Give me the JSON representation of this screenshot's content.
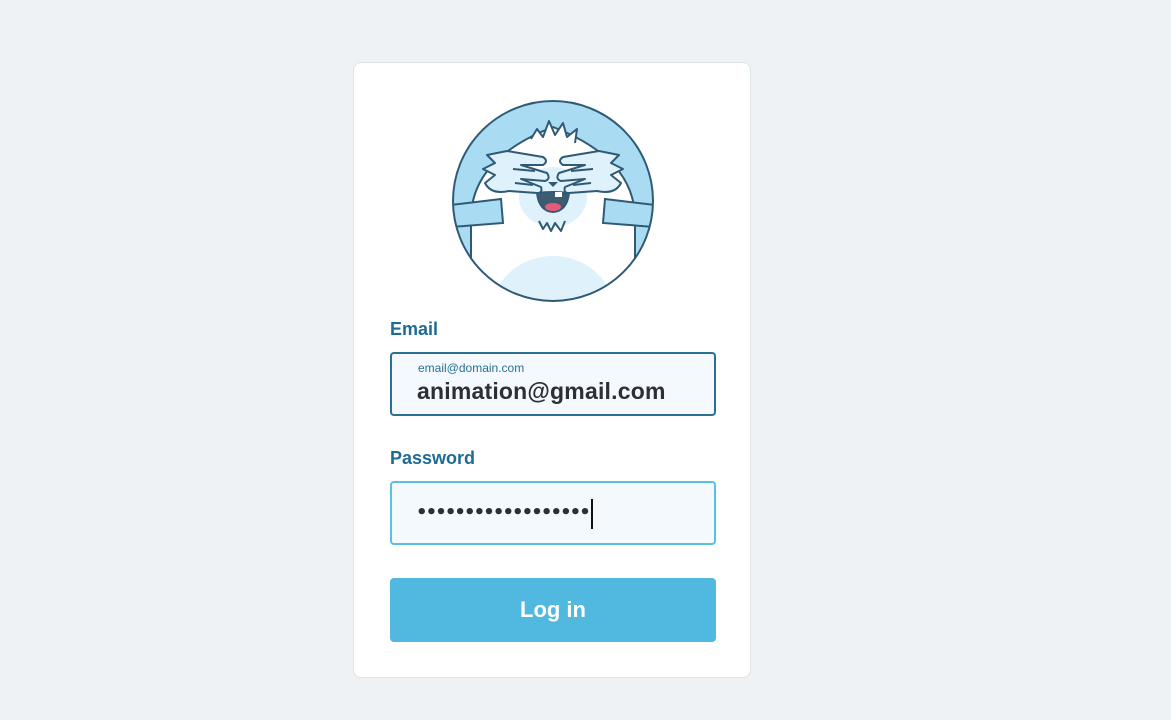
{
  "form": {
    "email": {
      "label": "Email",
      "placeholder": "email@domain.com",
      "value": "animation@gmail.com"
    },
    "password": {
      "label": "Password",
      "masked_value": "••••••••••••••••••"
    },
    "submit_label": "Log in"
  },
  "avatar": {
    "icon": "yeti-covering-eyes-icon"
  },
  "colors": {
    "background": "#eef2f4",
    "label": "#1f6b93",
    "email_border": "#2b6f93",
    "password_border": "#5bbfe2",
    "button": "#51b9df"
  }
}
